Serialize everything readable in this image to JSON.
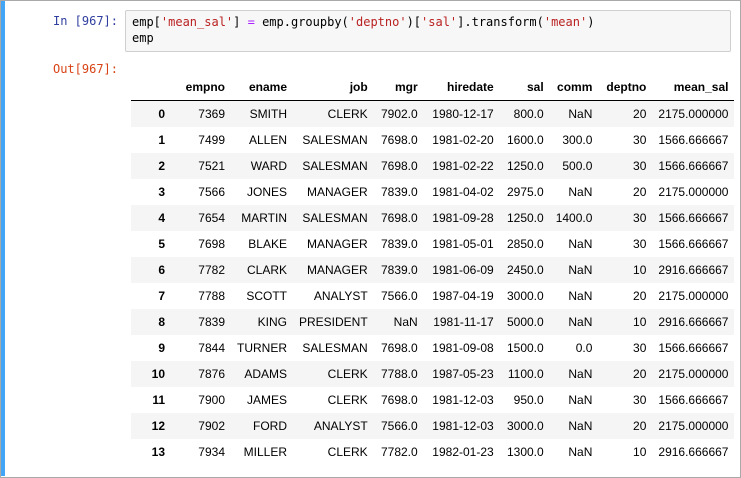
{
  "input_prompt": "In [967]:",
  "output_prompt": "Out[967]:",
  "code": {
    "line1": {
      "p1": "emp[",
      "s1": "'mean_sal'",
      "p2": "] ",
      "o1": "=",
      "p3": " emp.groupby(",
      "s2": "'deptno'",
      "p4": ")[",
      "s3": "'sal'",
      "p5": "].transform(",
      "s4": "'mean'",
      "p6": ")"
    },
    "line2": "emp"
  },
  "table": {
    "columns": [
      "",
      "empno",
      "ename",
      "job",
      "mgr",
      "hiredate",
      "sal",
      "comm",
      "deptno",
      "mean_sal"
    ],
    "rows": [
      [
        "0",
        "7369",
        "SMITH",
        "CLERK",
        "7902.0",
        "1980-12-17",
        "800.0",
        "NaN",
        "20",
        "2175.000000"
      ],
      [
        "1",
        "7499",
        "ALLEN",
        "SALESMAN",
        "7698.0",
        "1981-02-20",
        "1600.0",
        "300.0",
        "30",
        "1566.666667"
      ],
      [
        "2",
        "7521",
        "WARD",
        "SALESMAN",
        "7698.0",
        "1981-02-22",
        "1250.0",
        "500.0",
        "30",
        "1566.666667"
      ],
      [
        "3",
        "7566",
        "JONES",
        "MANAGER",
        "7839.0",
        "1981-04-02",
        "2975.0",
        "NaN",
        "20",
        "2175.000000"
      ],
      [
        "4",
        "7654",
        "MARTIN",
        "SALESMAN",
        "7698.0",
        "1981-09-28",
        "1250.0",
        "1400.0",
        "30",
        "1566.666667"
      ],
      [
        "5",
        "7698",
        "BLAKE",
        "MANAGER",
        "7839.0",
        "1981-05-01",
        "2850.0",
        "NaN",
        "30",
        "1566.666667"
      ],
      [
        "6",
        "7782",
        "CLARK",
        "MANAGER",
        "7839.0",
        "1981-06-09",
        "2450.0",
        "NaN",
        "10",
        "2916.666667"
      ],
      [
        "7",
        "7788",
        "SCOTT",
        "ANALYST",
        "7566.0",
        "1987-04-19",
        "3000.0",
        "NaN",
        "20",
        "2175.000000"
      ],
      [
        "8",
        "7839",
        "KING",
        "PRESIDENT",
        "NaN",
        "1981-11-17",
        "5000.0",
        "NaN",
        "10",
        "2916.666667"
      ],
      [
        "9",
        "7844",
        "TURNER",
        "SALESMAN",
        "7698.0",
        "1981-09-08",
        "1500.0",
        "0.0",
        "30",
        "1566.666667"
      ],
      [
        "10",
        "7876",
        "ADAMS",
        "CLERK",
        "7788.0",
        "1987-05-23",
        "1100.0",
        "NaN",
        "20",
        "2175.000000"
      ],
      [
        "11",
        "7900",
        "JAMES",
        "CLERK",
        "7698.0",
        "1981-12-03",
        "950.0",
        "NaN",
        "30",
        "1566.666667"
      ],
      [
        "12",
        "7902",
        "FORD",
        "ANALYST",
        "7566.0",
        "1981-12-03",
        "3000.0",
        "NaN",
        "20",
        "2175.000000"
      ],
      [
        "13",
        "7934",
        "MILLER",
        "CLERK",
        "7782.0",
        "1982-01-23",
        "1300.0",
        "NaN",
        "10",
        "2916.666667"
      ]
    ]
  },
  "colors": {
    "cell_selected_bar": "#42a5f5",
    "prompt_in": "#303f9f",
    "prompt_out": "#d84315",
    "string": "#ba2121",
    "operator": "#aa22ff"
  }
}
